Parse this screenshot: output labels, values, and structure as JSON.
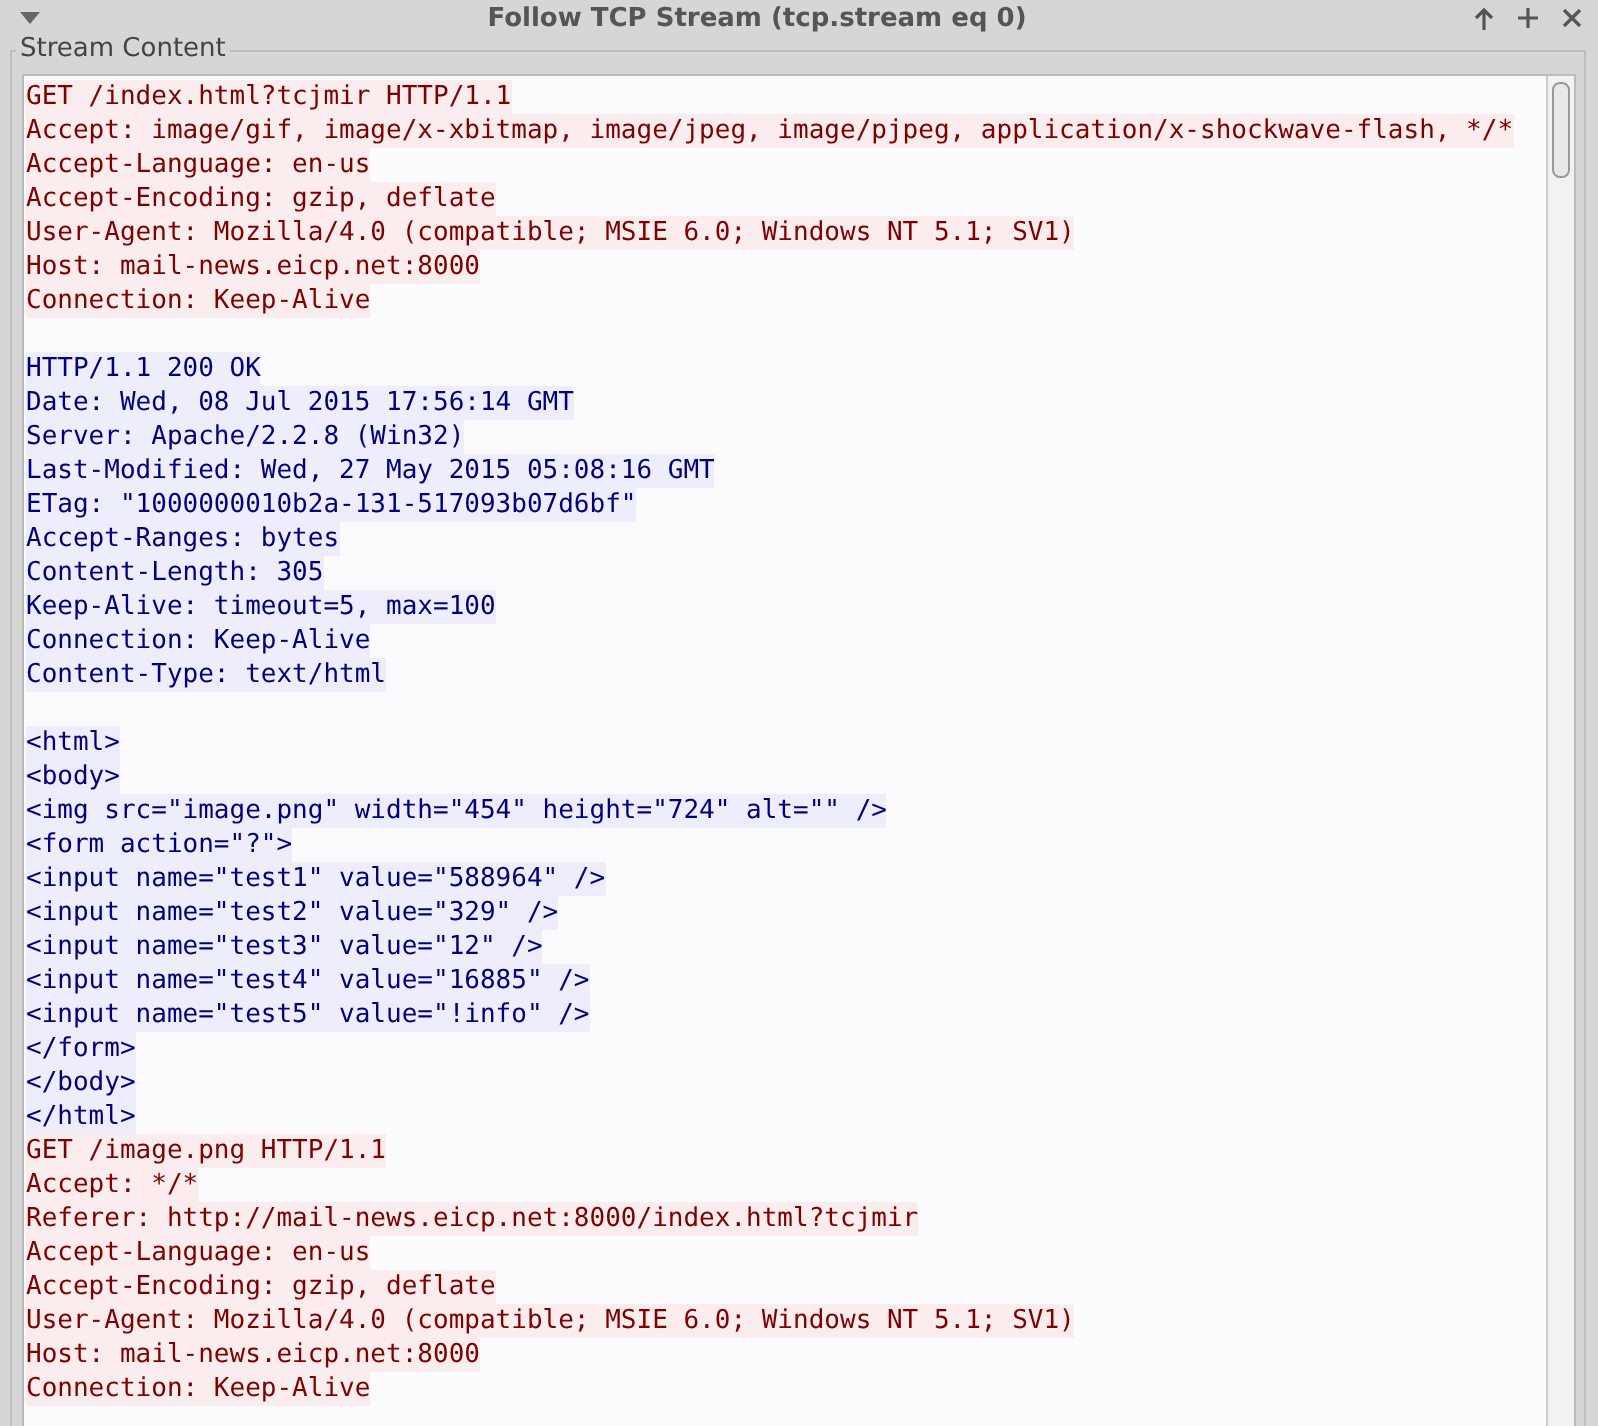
{
  "window": {
    "title": "Follow TCP Stream (tcp.stream eq 0)"
  },
  "frame": {
    "label": "Stream Content"
  },
  "blocks": [
    {
      "kind": "client",
      "lines": [
        "GET /index.html?tcjmir HTTP/1.1",
        "Accept: image/gif, image/x-xbitmap, image/jpeg, image/pjpeg, application/x-shockwave-flash, */*",
        "Accept-Language: en-us",
        "Accept-Encoding: gzip, deflate",
        "User-Agent: Mozilla/4.0 (compatible; MSIE 6.0; Windows NT 5.1; SV1)",
        "Host: mail-news.eicp.net:8000",
        "Connection: Keep-Alive"
      ]
    },
    {
      "kind": "server",
      "blank_before": true,
      "lines": [
        "HTTP/1.1 200 OK",
        "Date: Wed, 08 Jul 2015 17:56:14 GMT",
        "Server: Apache/2.2.8 (Win32)",
        "Last-Modified: Wed, 27 May 2015 05:08:16 GMT",
        "ETag: \"1000000010b2a-131-517093b07d6bf\"",
        "Accept-Ranges: bytes",
        "Content-Length: 305",
        "Keep-Alive: timeout=5, max=100",
        "Connection: Keep-Alive",
        "Content-Type: text/html"
      ]
    },
    {
      "kind": "server",
      "blank_before": true,
      "lines": [
        "<html>",
        "<body>",
        "<img src=\"image.png\" width=\"454\" height=\"724\" alt=\"\" />",
        "<form action=\"?\">",
        "<input name=\"test1\" value=\"588964\" />",
        "<input name=\"test2\" value=\"329\" />",
        "<input name=\"test3\" value=\"12\" />",
        "<input name=\"test4\" value=\"16885\" />",
        "<input name=\"test5\" value=\"!info\" />",
        "</form>",
        "</body>",
        "</html>"
      ]
    },
    {
      "kind": "client",
      "blank_before": false,
      "lines": [
        "GET /image.png HTTP/1.1",
        "Accept: */*",
        "Referer: http://mail-news.eicp.net:8000/index.html?tcjmir",
        "Accept-Language: en-us",
        "Accept-Encoding: gzip, deflate",
        "User-Agent: Mozilla/4.0 (compatible; MSIE 6.0; Windows NT 5.1; SV1)",
        "Host: mail-news.eicp.net:8000",
        "Connection: Keep-Alive"
      ]
    }
  ]
}
